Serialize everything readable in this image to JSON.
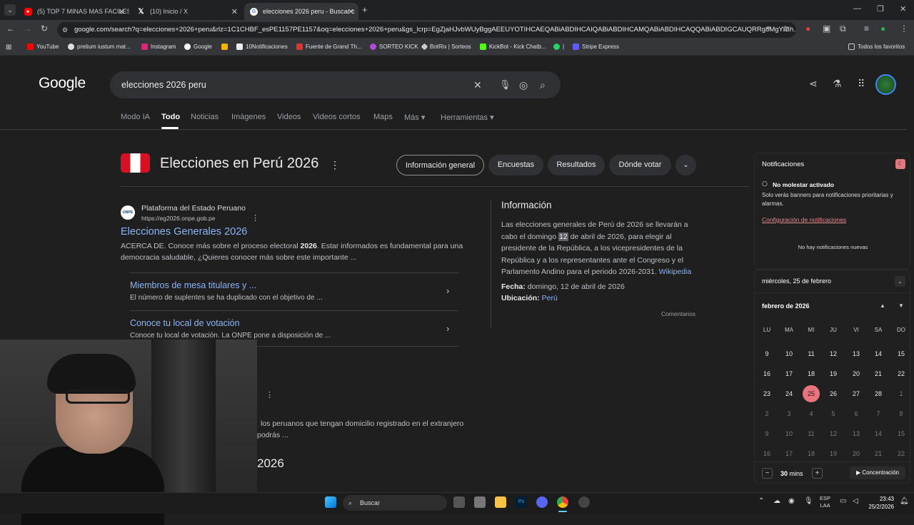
{
  "tabs": [
    {
      "title": "(5) TOP 7 MINAS MAS FACILES",
      "icon": "youtube-icon",
      "active": false
    },
    {
      "title": "(10) Inicio / X",
      "icon": "x-icon",
      "active": false
    },
    {
      "title": "elecciones 2026 peru - Buscar c",
      "icon": "google-icon",
      "active": true
    }
  ],
  "new_tab": "+",
  "url": "google.com/search?q=elecciones+2026+peru&rlz=1C1CHBF_esPE1157PE1157&oq=elecciones+2026+peru&gs_lcrp=EgZjaHJvbWUyBggAEEUYOTIHCAEQABiABDIHCAIQABiABDIHCAMQABiABDIHCAQQABiABDIGCAUQRRg8MgYIBh...",
  "bookmarks": [
    "YouTube",
    "pretium iustum mat...",
    "Instagram",
    "Google",
    "",
    "10Notificaciones",
    "Fuente de Grand Th...",
    "SORTEO KICK",
    "BotRix | Sorteos",
    "KickBot - Kick Chatb...",
    "|",
    "Stripe Express"
  ],
  "bookmarks_folder": "Todos los favoritos",
  "google": {
    "logo": "Google",
    "query": "elecciones 2026 peru",
    "nav": [
      "Modo IA",
      "Todo",
      "Noticias",
      "Imágenes",
      "Videos",
      "Videos cortos",
      "Maps",
      "Más ▾",
      "Herramientas ▾"
    ],
    "entity_title": "Elecciones en Perú 2026",
    "chips": [
      "Información general",
      "Encuestas",
      "Resultados",
      "Dónde votar"
    ],
    "result": {
      "site": "Plataforma del Estado Peruano",
      "url": "https://eg2026.onpe.gob.pe",
      "favicon": "ONPE",
      "title": "Elecciones Generales 2026",
      "snippet_a": "ACERCA DE. Conoce más sobre el proceso electoral ",
      "snippet_bold": "2026",
      "snippet_b": ". Estar informados es fundamental para una democracia saludable, ¿Quieres conocer más sobre este importante ...",
      "sublinks": [
        {
          "title": "Miembros de mesa titulares y ...",
          "desc": "El número de suplentes se ha duplicado con el objetivo de ..."
        },
        {
          "title": "Conoce tu local de votación",
          "desc": "Conoce tu local de votación. La ONPE pone a disposición de ..."
        }
      ],
      "partial_snippet_1": "los peruanos que tengan domicilio registrado en el extranjero",
      "partial_snippet_2": "podrás ...",
      "partial_title": "2026"
    },
    "info": {
      "heading": "Información",
      "p1": "Las elecciones generales de Perú de 2026 se llevarán a cabo el domingo ",
      "p1_day": "12",
      "p1b": " de abril de 2026, para elegir al presidente de la República, a los vicepresidentes de la República y a los representantes ante el Congreso y el Parlamento Andino para el periodo 2026-2031. ",
      "wiki": "Wikipedia",
      "fecha_label": "Fecha:",
      "fecha": "domingo, 12 de abril de 2026",
      "ubic_label": "Ubicación:",
      "ubic": "Perú",
      "comments": "Comentarios"
    }
  },
  "notifications": {
    "title": "Notificaciones",
    "dnd_title": "No molestar activado",
    "dnd_text": "Solo verás banners para notificaciones prioritarias y alarmas.",
    "config_link": "Configuración de notificaciones",
    "empty": "No hay notificaciones nuevas"
  },
  "calendar": {
    "date_header": "miércoles, 25 de febrero",
    "month": "febrero de 2026",
    "dow": [
      "LU",
      "MA",
      "MI",
      "JU",
      "VI",
      "SA",
      "DO"
    ],
    "weeks": [
      [
        "9",
        "10",
        "11",
        "12",
        "13",
        "14",
        "15"
      ],
      [
        "16",
        "17",
        "18",
        "19",
        "20",
        "21",
        "22"
      ],
      [
        "23",
        "24",
        "25",
        "26",
        "27",
        "28",
        "1"
      ],
      [
        "2",
        "3",
        "4",
        "5",
        "6",
        "7",
        "8"
      ],
      [
        "9",
        "10",
        "11",
        "12",
        "13",
        "14",
        "15"
      ],
      [
        "16",
        "17",
        "18",
        "19",
        "20",
        "21",
        "22"
      ]
    ],
    "today": "25",
    "focus_minutes": "30",
    "focus_unit": "mins",
    "focus_button": "Concentración"
  },
  "taskbar": {
    "search": "Buscar",
    "lang": "ESP",
    "lang2": "LAA",
    "time": "23:43",
    "date": "25/2/2026"
  }
}
